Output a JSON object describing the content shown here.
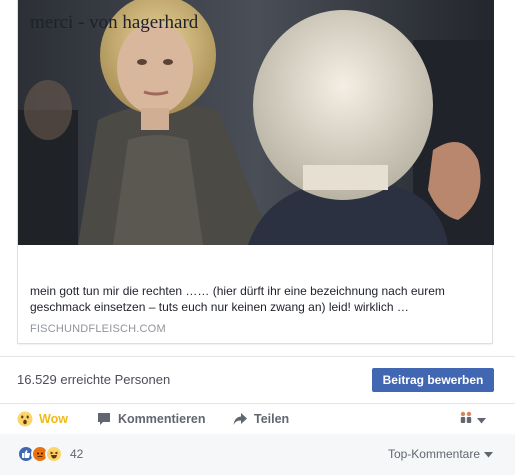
{
  "post": {
    "link_title": "merci - von hagerhard",
    "link_description": "mein gott tun mir die rechten …… (hier dürft ihr eine bezeichnung nach eurem geschmack einsetzen – tuts euch nur keinen zwang an) leid! wirklich …",
    "link_domain": "FISCHUNDFLEISCH.COM",
    "reach_text": "16.529 erreichte Personen",
    "promote_label": "Beitrag bewerben"
  },
  "actions": {
    "wow_label": "Wow",
    "comment_label": "Kommentieren",
    "share_label": "Teilen",
    "wow_icon": "wow-emoji-icon",
    "comment_icon": "speech-bubble-icon",
    "share_icon": "share-arrow-icon",
    "audience_icon": "people-icon"
  },
  "reactions": {
    "count": "42",
    "icons": [
      "like-icon",
      "angry-icon",
      "haha-icon"
    ],
    "sort_label": "Top-Kommentare"
  },
  "colors": {
    "primary": "#4267b2",
    "wow": "#f0ba15",
    "muted": "#616770",
    "domain": "#90949c"
  }
}
